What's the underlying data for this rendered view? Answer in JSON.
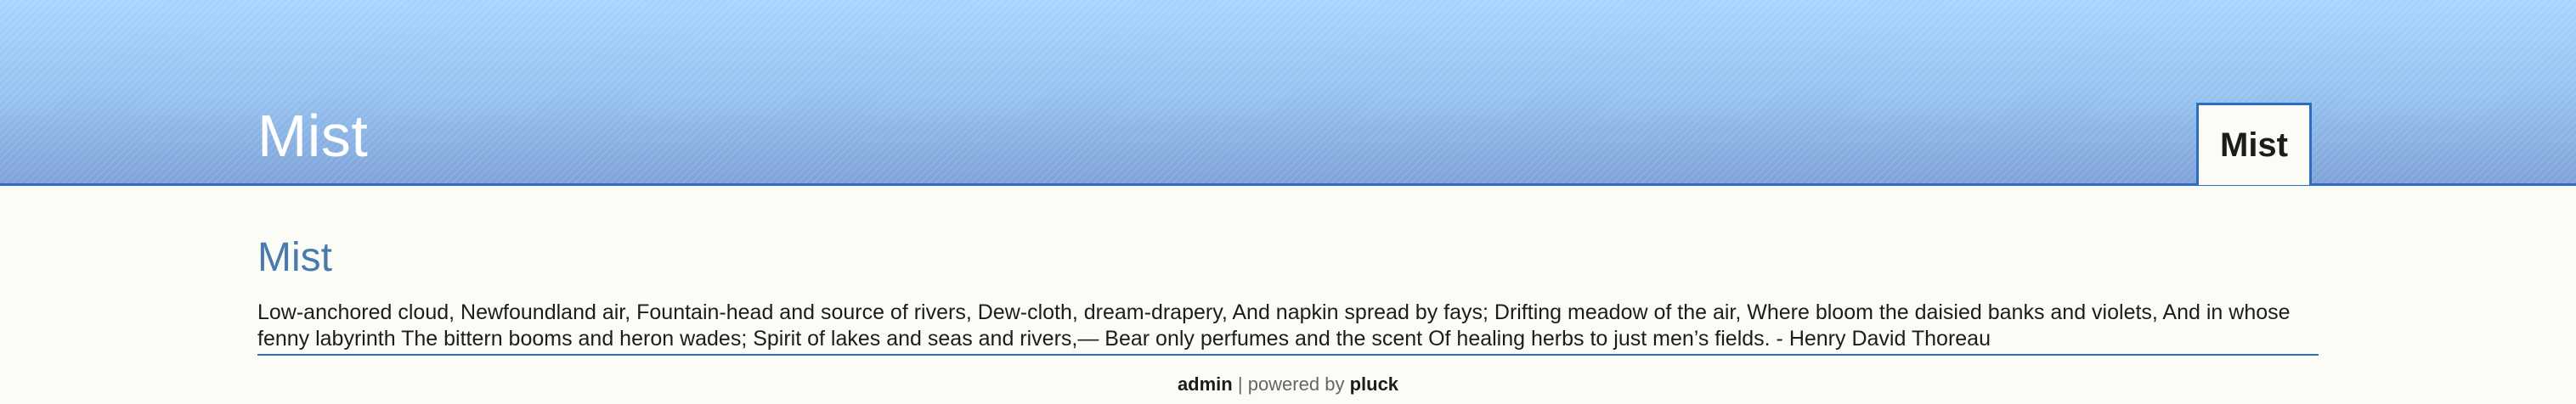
{
  "header": {
    "site_title": "Mist"
  },
  "nav": {
    "items": [
      {
        "label": "Mist",
        "active": true
      }
    ]
  },
  "main": {
    "heading": "Mist",
    "text": "Low-anchored cloud, Newfoundland air, Fountain-head and source of rivers, Dew-cloth, dream-drapery, And napkin spread by fays; Drifting meadow of the air, Where bloom the daisied banks and violets, And in whose fenny labyrinth The bittern booms and heron wades; Spirit of lakes and seas and rivers,— Bear only perfumes and the scent Of healing herbs to just men’s fields. - Henry David Thoreau"
  },
  "footer": {
    "admin_label": "admin",
    "separator": "|",
    "powered_text": "powered by",
    "pluck_label": "pluck"
  },
  "colors": {
    "header_gradient_top": "#a6d6fd",
    "header_gradient_bottom": "#7fa3d8",
    "accent_border": "#2d6cc0",
    "heading_color": "#4a7bae",
    "page_background": "#fcfcf6"
  }
}
